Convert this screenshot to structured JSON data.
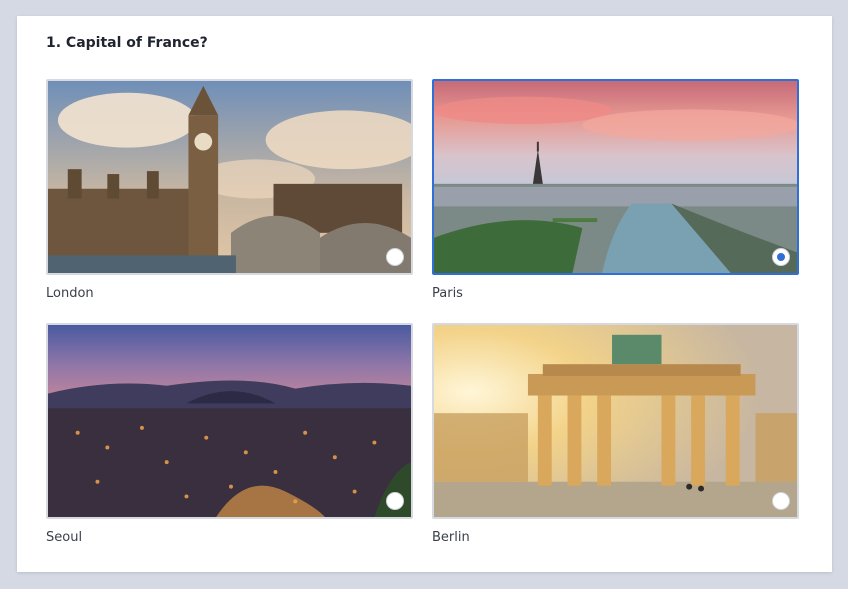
{
  "question": {
    "title": "1. Capital of France?"
  },
  "options": [
    {
      "label": "London",
      "selected": false,
      "image": "london-big-ben-photo"
    },
    {
      "label": "Paris",
      "selected": true,
      "image": "paris-eiffel-seine-photo"
    },
    {
      "label": "Seoul",
      "selected": false,
      "image": "seoul-night-skyline-photo"
    },
    {
      "label": "Berlin",
      "selected": false,
      "image": "berlin-brandenburg-gate-photo"
    }
  ],
  "colors": {
    "accent": "#2f6fd6",
    "page_bg": "#d4d9e4",
    "card_bg": "#ffffff"
  }
}
